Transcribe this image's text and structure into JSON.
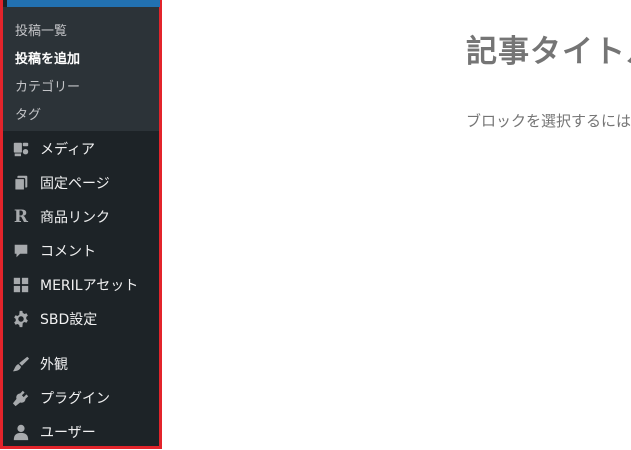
{
  "sidebar": {
    "submenu": [
      {
        "label": "投稿一覧",
        "current": false
      },
      {
        "label": "投稿を追加",
        "current": true
      },
      {
        "label": "カテゴリー",
        "current": false
      },
      {
        "label": "タグ",
        "current": false
      }
    ],
    "menu": [
      {
        "label": "メディア",
        "icon": "media-icon"
      },
      {
        "label": "固定ページ",
        "icon": "pages-icon"
      },
      {
        "label": "商品リンク",
        "icon": "r-logo-icon"
      },
      {
        "label": "コメント",
        "icon": "comment-icon"
      },
      {
        "label": "MERILアセット",
        "icon": "grid-icon"
      },
      {
        "label": "SBD設定",
        "icon": "gear-icon"
      },
      {
        "label": "外観",
        "icon": "brush-icon"
      },
      {
        "label": "プラグイン",
        "icon": "plugin-icon"
      },
      {
        "label": "ユーザー",
        "icon": "user-icon"
      }
    ],
    "r_logo_glyph": "R",
    "colors": {
      "background": "#1d2327",
      "submenu_background": "#2c3338",
      "highlight_border": "#e3242b",
      "accent": "#2271b1"
    }
  },
  "editor": {
    "title_placeholder": "記事タイトル",
    "block_placeholder": "ブロックを選択するには"
  }
}
